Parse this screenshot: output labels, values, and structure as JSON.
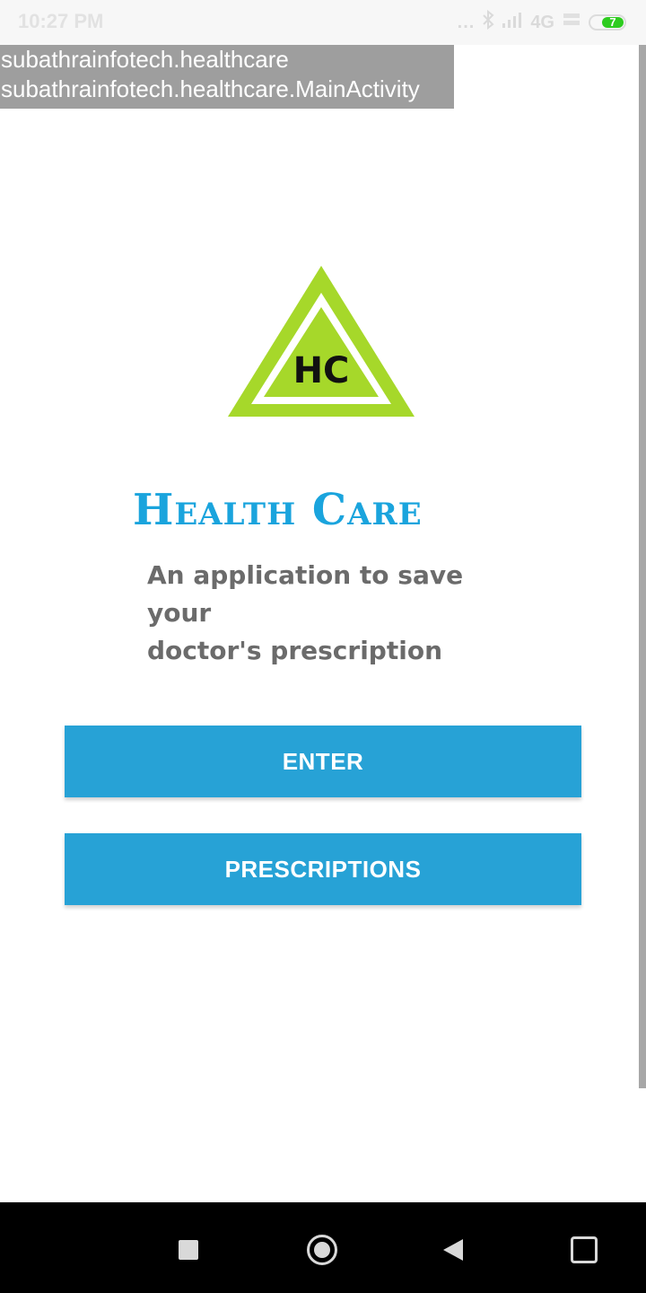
{
  "status_bar": {
    "time": "10:27 PM",
    "dots": "...",
    "network_type": "4G",
    "battery_level": "7",
    "icons": [
      "bluetooth-icon",
      "signal-icon",
      "volte-icon",
      "battery-icon"
    ]
  },
  "debug_overlay": {
    "package_name": "subathrainfotech.healthcare",
    "activity_name": "subathrainfotech.healthcare.MainActivity"
  },
  "logo": {
    "initials": "HC"
  },
  "brand": {
    "title": "Health Care",
    "tagline_line1": "An application to save your",
    "tagline_line2": "doctor's prescription"
  },
  "buttons": {
    "enter_label": "ENTER",
    "prescriptions_label": "PRESCRIPTIONS"
  },
  "colors": {
    "accent_button": "#27a2d6",
    "brand_title": "#1aa4dd",
    "logo_green": "#a6d82a"
  }
}
